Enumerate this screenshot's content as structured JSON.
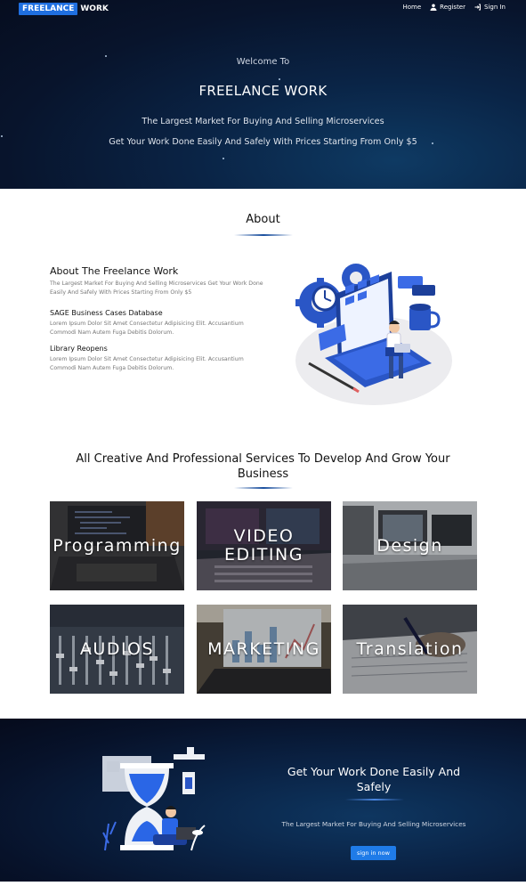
{
  "nav": {
    "logo_box": "FREELANCE",
    "logo_text": "WORK",
    "items": [
      {
        "label": "Home",
        "icon": ""
      },
      {
        "label": "Register",
        "icon": "user-icon"
      },
      {
        "label": "Sign In",
        "icon": "sign-in-icon"
      }
    ]
  },
  "hero": {
    "welcome": "Welcome To",
    "title": "FREELANCE WORK",
    "subtitle1": "The Largest Market For Buying And Selling Microservices",
    "subtitle2": "Get Your Work Done Easily And Safely With Prices Starting From Only $5"
  },
  "about": {
    "heading": "About",
    "title": "About The Freelance Work",
    "text": "The Largest Market For Buying And Selling Microservices Get Your Work Done Easily And Safely With Prices Starting From Only $5",
    "items": [
      {
        "title": "SAGE Business Cases Database",
        "text": "Lorem Ipsum Dolor Sit Amet Consectetur Adipisicing Elit. Accusantium Commodi Nam Autem Fuga Debitis Dolorum."
      },
      {
        "title": "Library Reopens",
        "text": "Lorem Ipsum Dolor Sit Amet Consectetur Adipisicing Elit. Accusantium Commodi Nam Autem Fuga Debitis Dolorum."
      }
    ]
  },
  "services": {
    "heading": "All Creative And Professional Services To Develop And Grow Your Business",
    "tiles": [
      {
        "label": "Programming"
      },
      {
        "label": "VIDEO EDITING"
      },
      {
        "label": "Design"
      },
      {
        "label": "AUDIOS"
      },
      {
        "label": "MARKETING"
      },
      {
        "label": "Translation"
      }
    ]
  },
  "cta": {
    "title": "Get Your Work Done Easily And Safely",
    "text": "The Largest Market For Buying And Selling Microservices",
    "button": "sign in now"
  },
  "colors": {
    "accent": "#1f6fe0",
    "hero_bg": "#08142c",
    "underline": "#1a4f9e"
  }
}
